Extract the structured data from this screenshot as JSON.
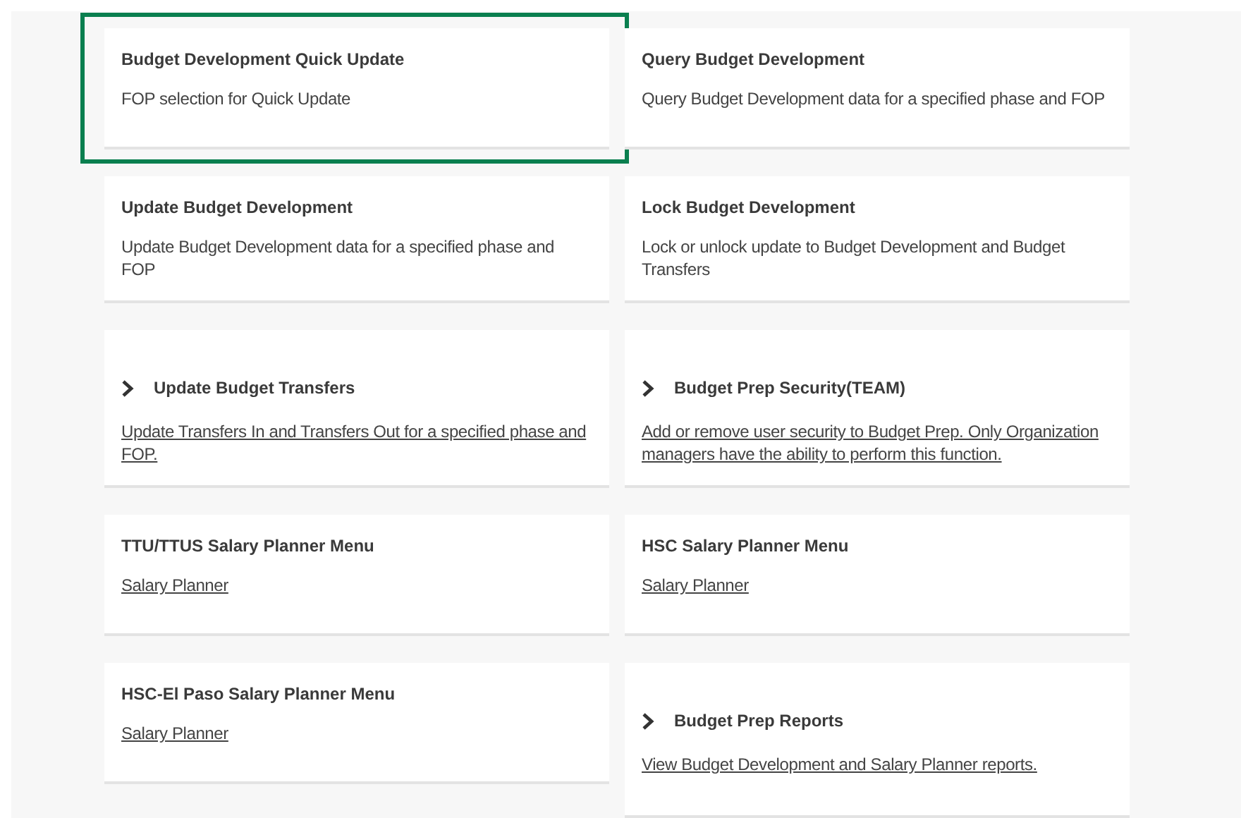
{
  "cards": [
    {
      "kind": "plain",
      "title": "Budget Development Quick Update",
      "text": "FOP selection for Quick Update",
      "highlighted": true
    },
    {
      "kind": "plain",
      "title": "Query Budget Development",
      "text": "Query Budget Development data for a specified phase and FOP",
      "highlighted": false
    },
    {
      "kind": "plain",
      "title": "Update Budget Development",
      "text": "Update Budget Development data for a specified phase and FOP",
      "highlighted": false
    },
    {
      "kind": "plain",
      "title": "Lock Budget Development",
      "text": "Lock or unlock update to Budget Development and Budget Transfers",
      "highlighted": false
    },
    {
      "kind": "expandable",
      "title": "Update Budget Transfers",
      "text": "Update Transfers In and Transfers Out for a specified phase and FOP.",
      "highlighted": false
    },
    {
      "kind": "expandable",
      "title": "Budget Prep Security(TEAM)",
      "text": "Add or remove user security to Budget Prep. Only Organization managers have the ability to perform this function.",
      "highlighted": false
    },
    {
      "kind": "menu",
      "title": "TTU/TTUS Salary Planner Menu",
      "text": "Salary Planner",
      "highlighted": false
    },
    {
      "kind": "menu",
      "title": "HSC Salary Planner Menu",
      "text": "Salary Planner",
      "highlighted": false
    },
    {
      "kind": "menu",
      "title": "HSC-El Paso Salary Planner Menu",
      "text": "Salary Planner",
      "highlighted": false
    },
    {
      "kind": "expandable",
      "title": "Budget Prep Reports",
      "text": "View Budget Development and Salary Planner reports.",
      "highlighted": false
    }
  ]
}
